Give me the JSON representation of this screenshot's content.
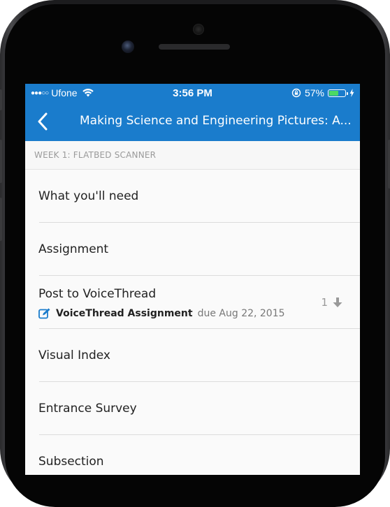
{
  "status_bar": {
    "signal_dots": "●●●○○",
    "carrier": "Ufone",
    "time": "3:56 PM",
    "battery_percent": "57%",
    "battery_level": 0.57,
    "icons": [
      "wifi-icon",
      "orientation-lock-icon",
      "battery-icon",
      "charging-bolt-icon"
    ]
  },
  "nav": {
    "title": "Making Science and Engineering Pictures: A...",
    "back_icon": "chevron-left-icon"
  },
  "section": {
    "header": "WEEK 1: FLATBED SCANNER"
  },
  "items": [
    {
      "label": "What you'll need"
    },
    {
      "label": "Assignment"
    },
    {
      "label": "Post to VoiceThread",
      "sub_icon": "edit-icon",
      "sub_bold": "VoiceThread Assignment",
      "sub_due": "due Aug 22, 2015",
      "count": "1",
      "right_icon": "download-arrow-icon"
    },
    {
      "label": "Visual Index"
    },
    {
      "label": "Entrance Survey"
    },
    {
      "label": "Subsection"
    }
  ],
  "colors": {
    "header_blue": "#1a7ccc",
    "battery_green": "#4cd964",
    "edit_icon_blue": "#1a7ccc"
  }
}
